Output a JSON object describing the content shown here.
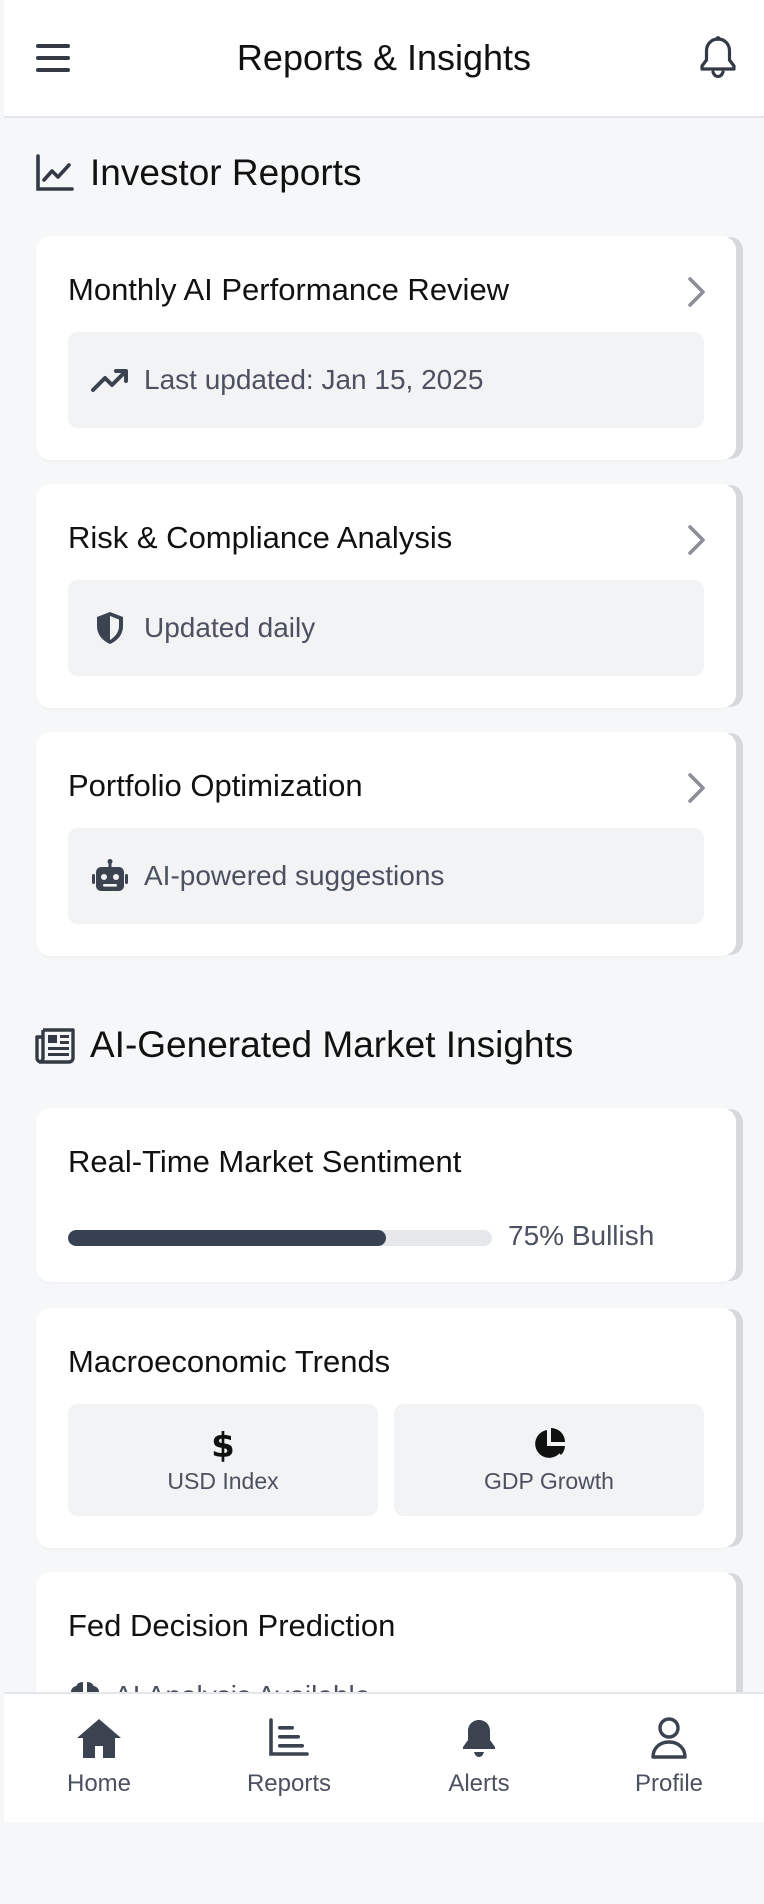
{
  "header": {
    "title": "Reports & Insights",
    "menu_icon": "hamburger-menu-icon",
    "bell_icon": "bell-icon"
  },
  "investor_reports": {
    "section_title": "Investor Reports",
    "icon": "line-chart-icon",
    "cards": [
      {
        "title": "Monthly AI Performance Review",
        "meta": "Last updated: Jan 15, 2025",
        "meta_icon": "trend-up-icon"
      },
      {
        "title": "Risk & Compliance Analysis",
        "meta": "Updated daily",
        "meta_icon": "shield-icon"
      },
      {
        "title": "Portfolio Optimization",
        "meta": "AI-powered suggestions",
        "meta_icon": "robot-icon"
      }
    ]
  },
  "market_insights": {
    "section_title": "AI-Generated Market Insights",
    "icon": "newspaper-icon",
    "sentiment": {
      "title": "Real-Time Market Sentiment",
      "progress": 0.75,
      "label": "75% Bullish"
    },
    "macro": {
      "title": "Macroeconomic Trends",
      "tiles": [
        {
          "label": "USD Index",
          "icon": "dollar-icon"
        },
        {
          "label": "GDP Growth",
          "icon": "pie-chart-icon"
        }
      ]
    },
    "fed": {
      "title": "Fed Decision Prediction",
      "meta": "AI Analysis Available",
      "meta_icon": "brain-icon"
    }
  },
  "bottom_nav": {
    "items": [
      {
        "label": "Home",
        "icon": "home-icon"
      },
      {
        "label": "Reports",
        "icon": "reports-icon"
      },
      {
        "label": "Alerts",
        "icon": "bell-icon"
      },
      {
        "label": "Profile",
        "icon": "user-icon"
      }
    ]
  },
  "colors": {
    "accent": "#374151",
    "muted_text": "#4b5160",
    "tile_bg": "#f2f3f5",
    "page_bg": "#f6f7f9"
  }
}
